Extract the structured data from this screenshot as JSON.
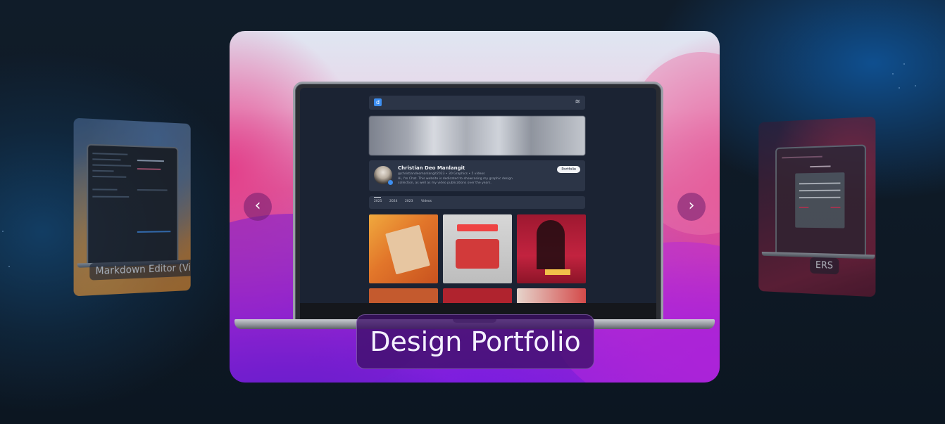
{
  "carousel": {
    "previous_label": "‹",
    "next_label": "›",
    "current": {
      "title": "Design Portfolio",
      "site": {
        "logo_icon": "portfolio-logo-icon",
        "layers_icon": "≋",
        "profile": {
          "name": "Christian Deo Manlangit",
          "meta": "@christiandeomanlangit2023  •  30 Graphics  •  5 videos",
          "bio": "Hi, I'm Chat. This website is dedicated to showcasing my graphic design collection, as well as my video publications over the years.",
          "button_label": "Portfolio"
        },
        "tabs": [
          "2025",
          "2024",
          "2023",
          "Videos"
        ]
      }
    },
    "previous": {
      "title": "Markdown Editor (Vite)"
    },
    "next": {
      "title": "ERS"
    }
  },
  "colors": {
    "background": "#0e1925",
    "accent_pink": "#e2458c",
    "accent_purple": "#8a20d6",
    "caption_bg": "#3e1068"
  }
}
